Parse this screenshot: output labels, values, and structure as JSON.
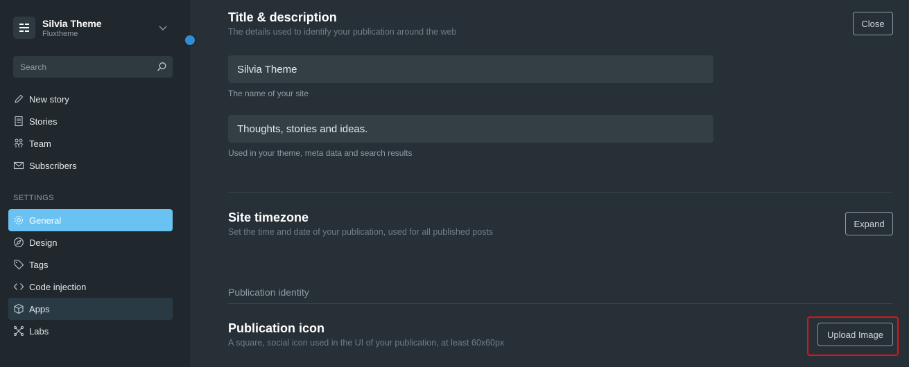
{
  "sidebar": {
    "brand": {
      "title": "Silvia Theme",
      "subtitle": "Fluxtheme",
      "logo_icon": "ghost-logo-icon",
      "chevron_icon": "chevron-down-icon"
    },
    "search": {
      "placeholder": "Search",
      "value": ""
    },
    "items": [
      {
        "label": "New story",
        "icon": "pencil-icon"
      },
      {
        "label": "Stories",
        "icon": "document-icon"
      },
      {
        "label": "Team",
        "icon": "team-icon"
      },
      {
        "label": "Subscribers",
        "icon": "mail-icon"
      }
    ],
    "settings_label": "SETTINGS",
    "settings_items": [
      {
        "label": "General",
        "icon": "gear-icon",
        "state": "active"
      },
      {
        "label": "Design",
        "icon": "compass-icon"
      },
      {
        "label": "Tags",
        "icon": "tag-icon"
      },
      {
        "label": "Code injection",
        "icon": "code-icon"
      },
      {
        "label": "Apps",
        "icon": "cube-icon",
        "state": "hover"
      },
      {
        "label": "Labs",
        "icon": "labs-icon"
      }
    ]
  },
  "main": {
    "title_section": {
      "heading": "Title & description",
      "description": "The details used to identify your publication around the web",
      "close_label": "Close",
      "title_value": "Silvia Theme",
      "title_hint": "The name of your site",
      "desc_value": "Thoughts, stories and ideas.",
      "desc_hint": "Used in your theme, meta data and search results"
    },
    "timezone_section": {
      "heading": "Site timezone",
      "description": "Set the time and date of your publication, used for all published posts",
      "expand_label": "Expand"
    },
    "identity": {
      "subheading": "Publication identity",
      "icon_heading": "Publication icon",
      "icon_description": "A square, social icon used in the UI of your publication, at least 60x60px",
      "upload_label": "Upload Image"
    }
  },
  "colors": {
    "accent": "#6ac2f3",
    "highlight": "#e3101a",
    "sidebar_bg": "#20282d",
    "main_bg": "#273036"
  }
}
